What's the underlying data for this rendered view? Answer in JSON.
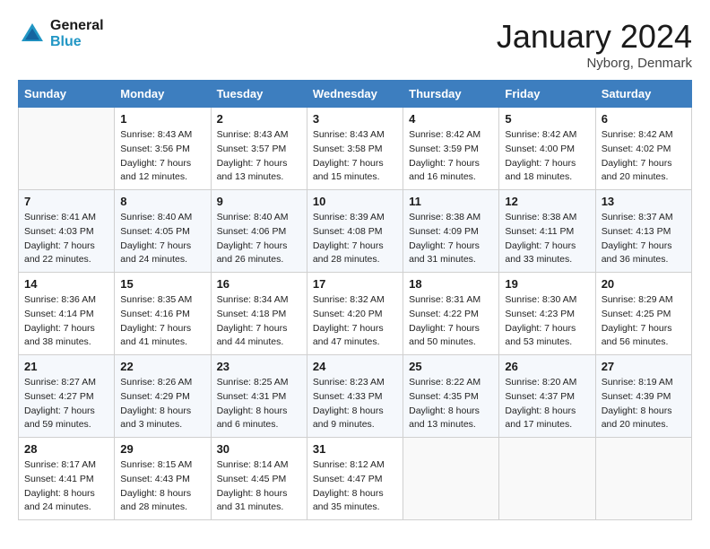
{
  "header": {
    "logo_line1": "General",
    "logo_line2": "Blue",
    "month_title": "January 2024",
    "location": "Nyborg, Denmark"
  },
  "days_of_week": [
    "Sunday",
    "Monday",
    "Tuesday",
    "Wednesday",
    "Thursday",
    "Friday",
    "Saturday"
  ],
  "weeks": [
    [
      {
        "day": "",
        "sunrise": "",
        "sunset": "",
        "daylight": ""
      },
      {
        "day": "1",
        "sunrise": "8:43 AM",
        "sunset": "3:56 PM",
        "daylight": "7 hours and 12 minutes."
      },
      {
        "day": "2",
        "sunrise": "8:43 AM",
        "sunset": "3:57 PM",
        "daylight": "7 hours and 13 minutes."
      },
      {
        "day": "3",
        "sunrise": "8:43 AM",
        "sunset": "3:58 PM",
        "daylight": "7 hours and 15 minutes."
      },
      {
        "day": "4",
        "sunrise": "8:42 AM",
        "sunset": "3:59 PM",
        "daylight": "7 hours and 16 minutes."
      },
      {
        "day": "5",
        "sunrise": "8:42 AM",
        "sunset": "4:00 PM",
        "daylight": "7 hours and 18 minutes."
      },
      {
        "day": "6",
        "sunrise": "8:42 AM",
        "sunset": "4:02 PM",
        "daylight": "7 hours and 20 minutes."
      }
    ],
    [
      {
        "day": "7",
        "sunrise": "8:41 AM",
        "sunset": "4:03 PM",
        "daylight": "7 hours and 22 minutes."
      },
      {
        "day": "8",
        "sunrise": "8:40 AM",
        "sunset": "4:05 PM",
        "daylight": "7 hours and 24 minutes."
      },
      {
        "day": "9",
        "sunrise": "8:40 AM",
        "sunset": "4:06 PM",
        "daylight": "7 hours and 26 minutes."
      },
      {
        "day": "10",
        "sunrise": "8:39 AM",
        "sunset": "4:08 PM",
        "daylight": "7 hours and 28 minutes."
      },
      {
        "day": "11",
        "sunrise": "8:38 AM",
        "sunset": "4:09 PM",
        "daylight": "7 hours and 31 minutes."
      },
      {
        "day": "12",
        "sunrise": "8:38 AM",
        "sunset": "4:11 PM",
        "daylight": "7 hours and 33 minutes."
      },
      {
        "day": "13",
        "sunrise": "8:37 AM",
        "sunset": "4:13 PM",
        "daylight": "7 hours and 36 minutes."
      }
    ],
    [
      {
        "day": "14",
        "sunrise": "8:36 AM",
        "sunset": "4:14 PM",
        "daylight": "7 hours and 38 minutes."
      },
      {
        "day": "15",
        "sunrise": "8:35 AM",
        "sunset": "4:16 PM",
        "daylight": "7 hours and 41 minutes."
      },
      {
        "day": "16",
        "sunrise": "8:34 AM",
        "sunset": "4:18 PM",
        "daylight": "7 hours and 44 minutes."
      },
      {
        "day": "17",
        "sunrise": "8:32 AM",
        "sunset": "4:20 PM",
        "daylight": "7 hours and 47 minutes."
      },
      {
        "day": "18",
        "sunrise": "8:31 AM",
        "sunset": "4:22 PM",
        "daylight": "7 hours and 50 minutes."
      },
      {
        "day": "19",
        "sunrise": "8:30 AM",
        "sunset": "4:23 PM",
        "daylight": "7 hours and 53 minutes."
      },
      {
        "day": "20",
        "sunrise": "8:29 AM",
        "sunset": "4:25 PM",
        "daylight": "7 hours and 56 minutes."
      }
    ],
    [
      {
        "day": "21",
        "sunrise": "8:27 AM",
        "sunset": "4:27 PM",
        "daylight": "7 hours and 59 minutes."
      },
      {
        "day": "22",
        "sunrise": "8:26 AM",
        "sunset": "4:29 PM",
        "daylight": "8 hours and 3 minutes."
      },
      {
        "day": "23",
        "sunrise": "8:25 AM",
        "sunset": "4:31 PM",
        "daylight": "8 hours and 6 minutes."
      },
      {
        "day": "24",
        "sunrise": "8:23 AM",
        "sunset": "4:33 PM",
        "daylight": "8 hours and 9 minutes."
      },
      {
        "day": "25",
        "sunrise": "8:22 AM",
        "sunset": "4:35 PM",
        "daylight": "8 hours and 13 minutes."
      },
      {
        "day": "26",
        "sunrise": "8:20 AM",
        "sunset": "4:37 PM",
        "daylight": "8 hours and 17 minutes."
      },
      {
        "day": "27",
        "sunrise": "8:19 AM",
        "sunset": "4:39 PM",
        "daylight": "8 hours and 20 minutes."
      }
    ],
    [
      {
        "day": "28",
        "sunrise": "8:17 AM",
        "sunset": "4:41 PM",
        "daylight": "8 hours and 24 minutes."
      },
      {
        "day": "29",
        "sunrise": "8:15 AM",
        "sunset": "4:43 PM",
        "daylight": "8 hours and 28 minutes."
      },
      {
        "day": "30",
        "sunrise": "8:14 AM",
        "sunset": "4:45 PM",
        "daylight": "8 hours and 31 minutes."
      },
      {
        "day": "31",
        "sunrise": "8:12 AM",
        "sunset": "4:47 PM",
        "daylight": "8 hours and 35 minutes."
      },
      {
        "day": "",
        "sunrise": "",
        "sunset": "",
        "daylight": ""
      },
      {
        "day": "",
        "sunrise": "",
        "sunset": "",
        "daylight": ""
      },
      {
        "day": "",
        "sunrise": "",
        "sunset": "",
        "daylight": ""
      }
    ]
  ],
  "labels": {
    "sunrise_prefix": "Sunrise: ",
    "sunset_prefix": "Sunset: ",
    "daylight_prefix": "Daylight: "
  }
}
